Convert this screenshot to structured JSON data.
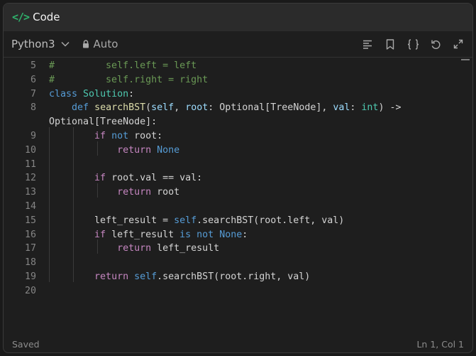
{
  "window": {
    "title": "Code",
    "icon": "code-brackets-icon",
    "accent_color": "#2fb26c"
  },
  "toolbar": {
    "language": "Python3",
    "mode": "Auto",
    "tools": [
      "format-icon",
      "bookmark-icon",
      "braces-icon",
      "undo-icon",
      "expand-icon"
    ]
  },
  "editor": {
    "lines": [
      {
        "num": "5",
        "tokens": [
          {
            "t": "#         self.left = left",
            "c": "comment"
          }
        ]
      },
      {
        "num": "6",
        "tokens": [
          {
            "t": "#         self.right = right",
            "c": "comment"
          }
        ]
      },
      {
        "num": "7",
        "tokens": [
          {
            "t": "class",
            "c": "kw"
          },
          {
            "t": " "
          },
          {
            "t": "Solution",
            "c": "cls"
          },
          {
            "t": ":"
          }
        ]
      },
      {
        "num": "8",
        "tokens": [
          {
            "t": "    "
          },
          {
            "t": "def",
            "c": "kw"
          },
          {
            "t": " "
          },
          {
            "t": "searchBST",
            "c": "fn"
          },
          {
            "t": "("
          },
          {
            "t": "self",
            "c": "param"
          },
          {
            "t": ", "
          },
          {
            "t": "root",
            "c": "param"
          },
          {
            "t": ": Optional[TreeNode], "
          },
          {
            "t": "val",
            "c": "param"
          },
          {
            "t": ": "
          },
          {
            "t": "int",
            "c": "cls"
          },
          {
            "t": ") ->"
          }
        ]
      },
      {
        "num": "",
        "tokens": [
          {
            "t": "Optional[TreeNode]:"
          }
        ]
      },
      {
        "num": "9",
        "tokens": [
          {
            "t": "        "
          },
          {
            "t": "if",
            "c": "flow"
          },
          {
            "t": " "
          },
          {
            "t": "not",
            "c": "kw"
          },
          {
            "t": " root:"
          }
        ]
      },
      {
        "num": "10",
        "tokens": [
          {
            "t": "            "
          },
          {
            "t": "return",
            "c": "flow"
          },
          {
            "t": " "
          },
          {
            "t": "None",
            "c": "kw"
          }
        ]
      },
      {
        "num": "11",
        "tokens": []
      },
      {
        "num": "12",
        "tokens": [
          {
            "t": "        "
          },
          {
            "t": "if",
            "c": "flow"
          },
          {
            "t": " root.val == val:"
          }
        ]
      },
      {
        "num": "13",
        "tokens": [
          {
            "t": "            "
          },
          {
            "t": "return",
            "c": "flow"
          },
          {
            "t": " root"
          }
        ]
      },
      {
        "num": "14",
        "tokens": []
      },
      {
        "num": "15",
        "tokens": [
          {
            "t": "        left_result = "
          },
          {
            "t": "self",
            "c": "kw"
          },
          {
            "t": ".searchBST(root.left, val)"
          }
        ]
      },
      {
        "num": "16",
        "tokens": [
          {
            "t": "        "
          },
          {
            "t": "if",
            "c": "flow"
          },
          {
            "t": " left_result "
          },
          {
            "t": "is",
            "c": "kw"
          },
          {
            "t": " "
          },
          {
            "t": "not",
            "c": "kw"
          },
          {
            "t": " "
          },
          {
            "t": "None",
            "c": "kw"
          },
          {
            "t": ":"
          }
        ]
      },
      {
        "num": "17",
        "tokens": [
          {
            "t": "            "
          },
          {
            "t": "return",
            "c": "flow"
          },
          {
            "t": " left_result"
          }
        ]
      },
      {
        "num": "18",
        "tokens": []
      },
      {
        "num": "19",
        "tokens": [
          {
            "t": "        "
          },
          {
            "t": "return",
            "c": "flow"
          },
          {
            "t": " "
          },
          {
            "t": "self",
            "c": "kw"
          },
          {
            "t": ".searchBST(root.right, val)"
          }
        ]
      },
      {
        "num": "20",
        "tokens": []
      }
    ]
  },
  "status": {
    "left": "Saved",
    "right": "Ln 1, Col 1"
  }
}
